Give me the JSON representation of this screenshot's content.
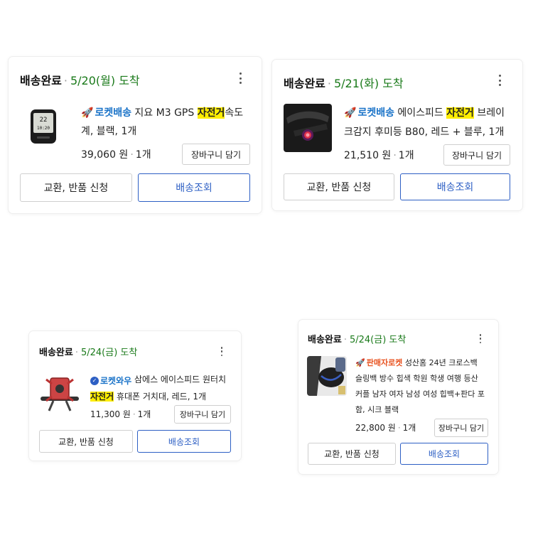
{
  "colors": {
    "date": "#1a7a1a",
    "rocket": "#1a73c8",
    "seller_rocket": "#e8521f",
    "highlight": "#ffee00",
    "primary_button": "#2d5fc4"
  },
  "orders": [
    {
      "status": "배송완료",
      "date_text": "5/20(월) 도착",
      "badge": "로켓배송",
      "badge_icon": "rocket-icon",
      "title_before": "지요 M3 GPS ",
      "title_highlight": "자전거",
      "title_after_line1": "속도",
      "title_line2": "계, 블랙, 1개",
      "price": "39,060 원",
      "qty": "1개",
      "cart_label": "장바구니 담기",
      "exchange_label": "교환, 반품 신청",
      "track_label": "배송조회",
      "thumb_icon": "gps-bike-computer-image"
    },
    {
      "status": "배송완료",
      "date_text": "5/21(화) 도착",
      "badge": "로켓배송",
      "badge_icon": "rocket-icon",
      "title_before": "에이스피드 ",
      "title_highlight": "자전거",
      "title_after_line1": " 브레이",
      "title_line2": "크감지 후미등 B80, 레드 + 블루, 1개",
      "price": "21,510 원",
      "qty": "1개",
      "cart_label": "장바구니 담기",
      "exchange_label": "교환, 반품 신청",
      "track_label": "배송조회",
      "thumb_icon": "bike-tail-light-image"
    },
    {
      "status": "배송완료",
      "date_text": "5/24(금) 도착",
      "badge": "로켓와우",
      "badge_icon": "rocket-wow-icon",
      "title_before": "삼에스 에이스피드 원터치",
      "title_highlight": "자전거",
      "title_after_line1": " 휴대폰 거치대, 레드, 1개",
      "price": "11,300 원",
      "qty": "1개",
      "cart_label": "장바구니 담기",
      "exchange_label": "교환, 반품 신청",
      "track_label": "배송조회",
      "thumb_icon": "phone-holder-image"
    },
    {
      "status": "배송완료",
      "date_text": "5/24(금) 도착",
      "badge": "판매자로켓",
      "badge_icon": "seller-rocket-icon",
      "title_line1_text": "성산홈 24년 크로스백",
      "title_line2": "슬링백 방수 힙색 학원 학생 여행 등산",
      "title_line3": "커플 남자 여자 남성 여성 힙백+판다 포",
      "title_line4": "함, 시크 블랙",
      "price": "22,800 원",
      "qty": "1개",
      "cart_label": "장바구니 담기",
      "exchange_label": "교환, 반품 신청",
      "track_label": "배송조회",
      "thumb_icon": "sling-bag-image"
    }
  ]
}
